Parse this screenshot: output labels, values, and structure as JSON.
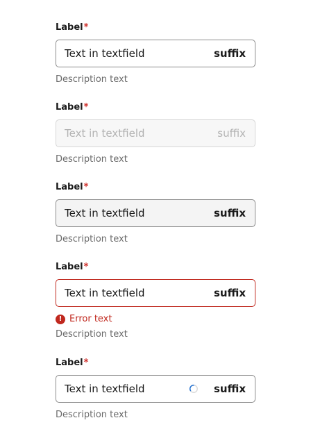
{
  "fields": [
    {
      "label": "Label",
      "required_mark": "*",
      "value": "Text in textfield",
      "suffix": "suffix",
      "description": "Description text",
      "state": "default"
    },
    {
      "label": "Label",
      "required_mark": "*",
      "value": "Text in textfield",
      "suffix": "suffix",
      "description": "Description text",
      "state": "disabled"
    },
    {
      "label": "Label",
      "required_mark": "*",
      "value": "Text in textfield",
      "suffix": "suffix",
      "description": "Description text",
      "state": "readonly"
    },
    {
      "label": "Label",
      "required_mark": "*",
      "value": "Text in textfield",
      "suffix": "suffix",
      "error": "Error text",
      "error_icon": "!",
      "description": "Description text",
      "state": "error"
    },
    {
      "label": "Label",
      "required_mark": "*",
      "value": "Text in textfield",
      "suffix": "suffix",
      "description": "Description text",
      "state": "loading"
    }
  ],
  "colors": {
    "required": "#d0312d",
    "error": "#c0281e",
    "border": "#8a8a8a",
    "spinner": "#1f6fd1"
  }
}
